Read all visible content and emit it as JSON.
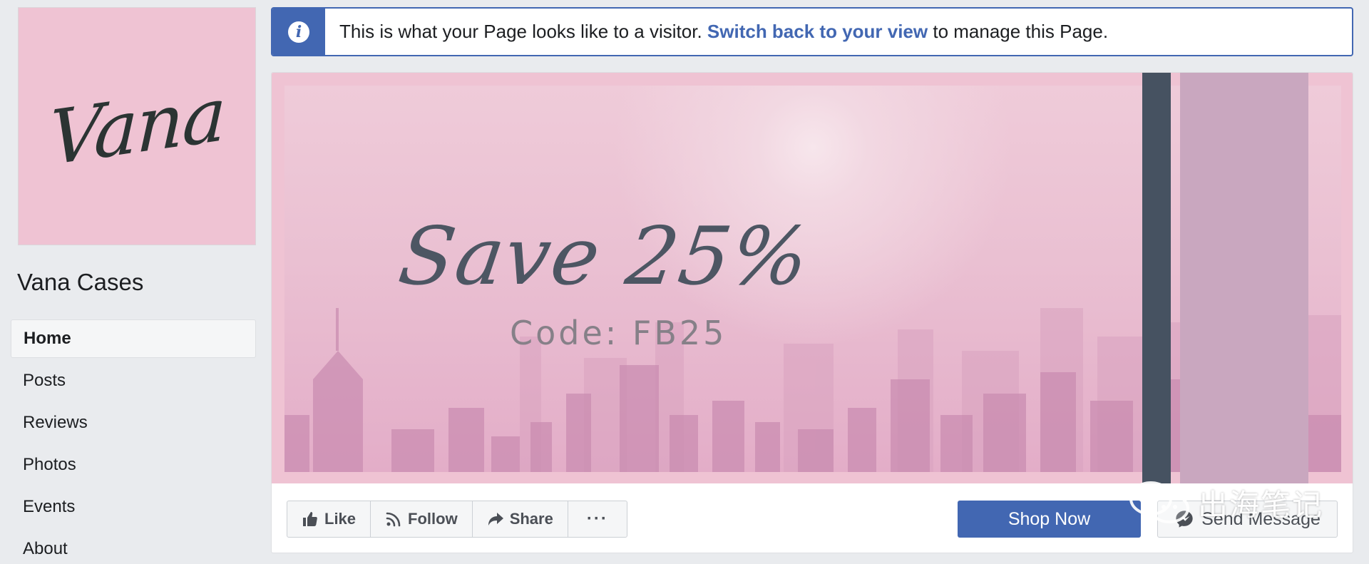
{
  "profile": {
    "logo_text": "Vana",
    "name": "Vana Cases"
  },
  "nav": {
    "items": [
      {
        "label": "Home",
        "active": true
      },
      {
        "label": "Posts"
      },
      {
        "label": "Reviews"
      },
      {
        "label": "Photos"
      },
      {
        "label": "Events"
      },
      {
        "label": "About"
      }
    ]
  },
  "notice": {
    "icon": "info-icon",
    "text_before": "This is what your Page looks like to a visitor.",
    "link_text": "Switch back to your view",
    "text_after": "to manage this Page."
  },
  "cover": {
    "headline": "Save 25%",
    "code_line": "Code: FB25"
  },
  "actions": {
    "like_label": "Like",
    "follow_label": "Follow",
    "share_label": "Share",
    "more_label": "···",
    "shop_label": "Shop Now",
    "message_label": "Send Message"
  },
  "watermark": {
    "text": "出海笔记"
  },
  "colors": {
    "accent": "#4267b2",
    "background": "#e9ebee",
    "cover_pink": "#efc3d3",
    "dark_bar": "#465261",
    "mauve_bar": "#c9a7bf"
  }
}
